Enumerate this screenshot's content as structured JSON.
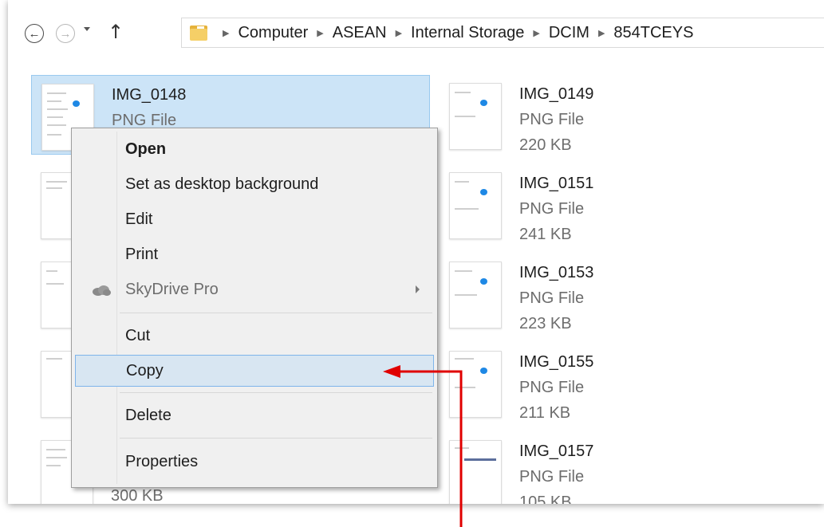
{
  "nav": {
    "back_glyph": "←",
    "forward_glyph": "→",
    "up_glyph": "↑",
    "breadcrumb": [
      "Computer",
      "ASEAN",
      "Internal Storage",
      "DCIM",
      "854TCEYS"
    ],
    "separator_glyph": "▶"
  },
  "files": {
    "left": [
      {
        "name": "IMG_0148",
        "type": "PNG File",
        "size": ""
      },
      {
        "name": "",
        "type": "",
        "size": "300 KB"
      }
    ],
    "right": [
      {
        "name": "IMG_0149",
        "type": "PNG File",
        "size": "220 KB"
      },
      {
        "name": "IMG_0151",
        "type": "PNG File",
        "size": "241 KB"
      },
      {
        "name": "IMG_0153",
        "type": "PNG File",
        "size": "223 KB"
      },
      {
        "name": "IMG_0155",
        "type": "PNG File",
        "size": "211 KB"
      },
      {
        "name": "IMG_0157",
        "type": "PNG File",
        "size": "105 KB"
      }
    ]
  },
  "context_menu": {
    "open": "Open",
    "set_desktop": "Set as desktop background",
    "edit": "Edit",
    "print": "Print",
    "skydrive": "SkyDrive Pro",
    "cut": "Cut",
    "copy": "Copy",
    "delete": "Delete",
    "properties": "Properties"
  },
  "colors": {
    "selection": "#cce4f7",
    "menu_hover": "#d8e6f2",
    "annotation_arrow": "#e00000"
  }
}
